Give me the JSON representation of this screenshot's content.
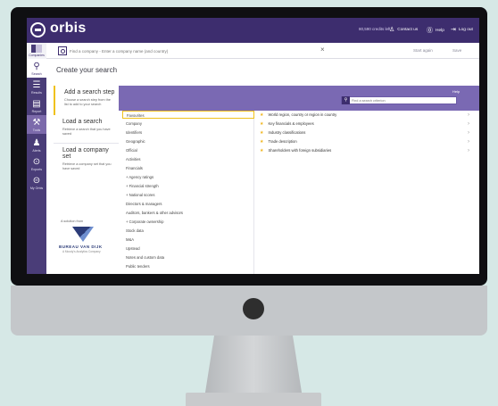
{
  "app": {
    "name": "orbis",
    "credits": "80,590 credits left",
    "contact": "Contact us",
    "help": "Help",
    "logout": "Log out"
  },
  "search": {
    "placeholder": "Find a company - Enter a company name (and country)",
    "start_again": "Start again",
    "save": "Save"
  },
  "sidebar": {
    "companies": "Companies",
    "items": [
      {
        "label": "Search",
        "icon": "search-icon"
      },
      {
        "label": "Results",
        "icon": "results-icon"
      },
      {
        "label": "Report",
        "icon": "report-icon"
      },
      {
        "label": "Tools",
        "icon": "tools-icon"
      },
      {
        "label": "Alerts",
        "icon": "bell-icon"
      },
      {
        "label": "Exports",
        "icon": "export-icon"
      },
      {
        "label": "My Orbis",
        "icon": "orbis-icon"
      }
    ]
  },
  "main": {
    "title": "Create your search",
    "help": "Help",
    "step_search_placeholder": "Find a search criterion",
    "steps": [
      {
        "title": "Add a search step",
        "desc": "Choose a search step from the list to add to your search"
      },
      {
        "title": "Load a search",
        "desc": "Retrieve a search that you have saved"
      },
      {
        "title": "Load a company set",
        "desc": "Retrieve a company set that you have saved"
      }
    ],
    "categories": [
      "Favourites",
      "Company",
      "Identifiers",
      "Geographic",
      "Official",
      "Activities",
      "Financials",
      "+ Agency ratings",
      "+ Financial strength",
      "+ National scores",
      "Directors & managers",
      "Auditors, bankers & other advisors",
      "+ Corporate ownership",
      "Stock data",
      "M&A",
      "Upstead",
      "Notes and custom data",
      "Public tenders"
    ],
    "options": [
      "World region, country or region in country",
      "Key financials & employees",
      "Industry classifications",
      "Trade description",
      "Shareholders with foreign subsidiaries"
    ]
  },
  "branding": {
    "solution_from": "A solution from",
    "company": "BUREAU VAN DIJK",
    "tagline": "A Moody's Analytics Company"
  },
  "colors": {
    "brand": "#3d2d6e",
    "accent": "#f0c11a",
    "panel": "#7a69b3"
  }
}
